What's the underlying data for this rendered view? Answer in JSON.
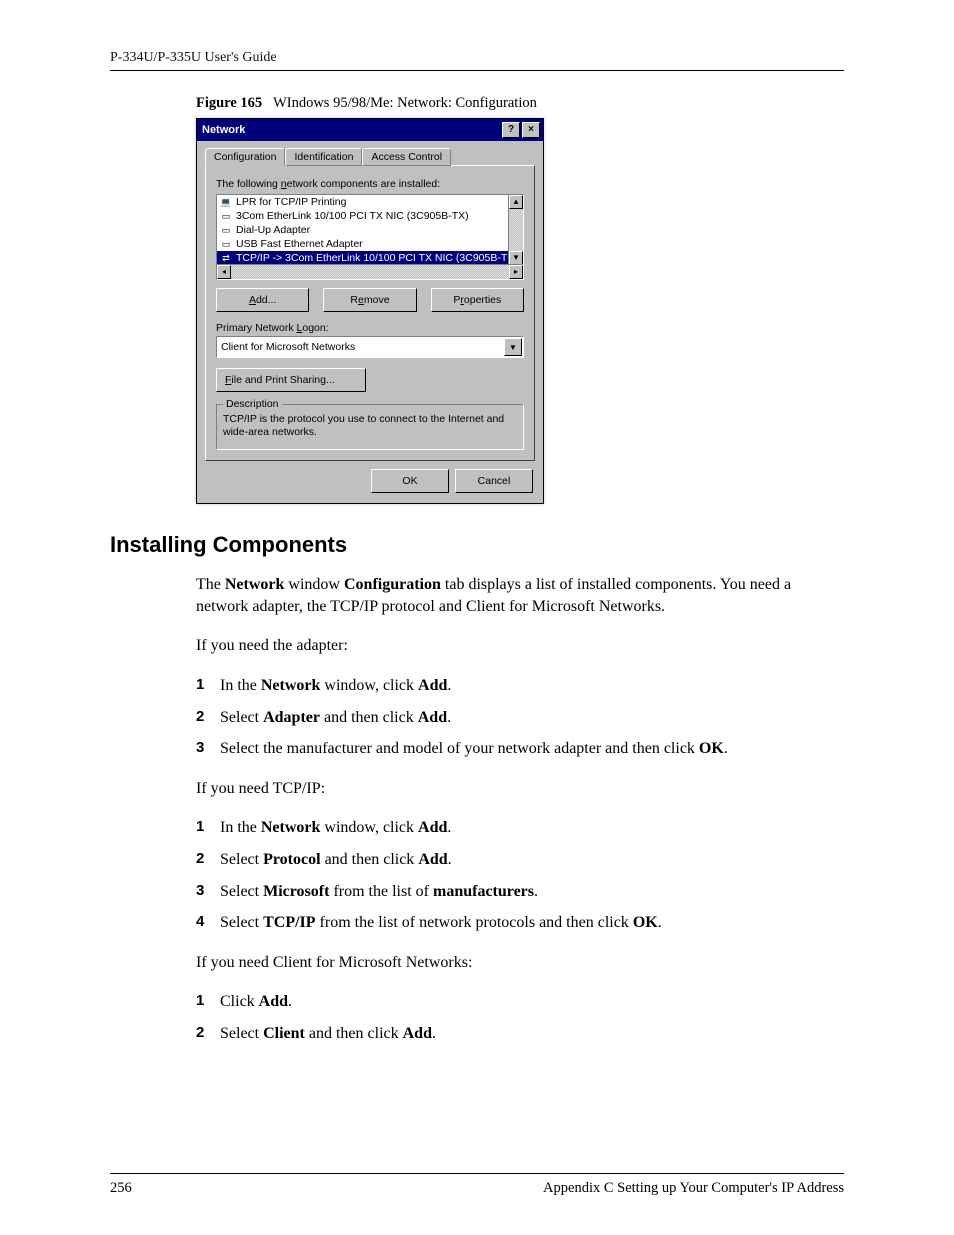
{
  "header": {
    "runningHead": "P-334U/P-335U User's Guide"
  },
  "figure": {
    "label": "Figure 165",
    "caption": "WIndows 95/98/Me: Network: Configuration"
  },
  "dialog": {
    "title": "Network",
    "tabs": [
      "Configuration",
      "Identification",
      "Access Control"
    ],
    "activeTab": 0,
    "listLabelPre": "The following ",
    "listLabelUnderline": "n",
    "listLabelPost": "etwork components are installed:",
    "listItems": [
      "LPR for TCP/IP Printing",
      "3Com EtherLink 10/100 PCI TX NIC (3C905B-TX)",
      "Dial-Up Adapter",
      "USB Fast Ethernet Adapter",
      "TCP/IP -> 3Com EtherLink 10/100 PCI TX NIC (3C905B-T"
    ],
    "selectedIndex": 4,
    "btnAdd": "Add...",
    "btnRemove": "Remove",
    "btnProperties": "Properties",
    "logonLabelPre": "Primary Network ",
    "logonLabelUnderline": "L",
    "logonLabelPost": "ogon:",
    "logonValue": "Client for Microsoft Networks",
    "btnFileShareUnderline": "F",
    "btnFileSharePost": "ile and Print Sharing...",
    "descLegend": "Description",
    "descText": "TCP/IP is the protocol you use to connect to the Internet and wide-area networks.",
    "btnOk": "OK",
    "btnCancel": "Cancel"
  },
  "section": {
    "heading": "Installing Components"
  },
  "body": {
    "intro": {
      "pre": "The ",
      "b1": "Network",
      "mid1": " window ",
      "b2": "Configuration",
      "post": " tab displays a list of installed components. You need a network adapter, the TCP/IP protocol and Client for Microsoft Networks."
    },
    "needAdapter": "If you need the adapter:",
    "adapterSteps": [
      {
        "pre": "In the ",
        "b1": "Network",
        "mid": " window, click ",
        "b2": "Add",
        "post": "."
      },
      {
        "pre": "Select ",
        "b1": "Adapter",
        "mid": " and then click ",
        "b2": "Add",
        "post": "."
      },
      {
        "pre": "Select the manufacturer and model of your network adapter and then click ",
        "b1": "OK",
        "post": "."
      }
    ],
    "needTcp": "If you need TCP/IP:",
    "tcpSteps": [
      {
        "pre": "In the ",
        "b1": "Network",
        "mid": " window, click ",
        "b2": "Add",
        "post": "."
      },
      {
        "pre": "Select ",
        "b1": "Protocol",
        "mid": " and then click ",
        "b2": "Add",
        "post": "."
      },
      {
        "pre": "Select ",
        "b1": "Microsoft",
        "mid": " from the list of ",
        "b2": "manufacturers",
        "post": "."
      },
      {
        "pre": "Select ",
        "b1": "TCP/IP",
        "mid": " from the list of network protocols and then click ",
        "b2": "OK",
        "post": "."
      }
    ],
    "needClient": "If you need Client for Microsoft Networks:",
    "clientSteps": [
      {
        "pre": "Click ",
        "b1": "Add",
        "post": "."
      },
      {
        "pre": "Select ",
        "b1": "Client",
        "mid": " and then click ",
        "b2": "Add",
        "post": "."
      }
    ]
  },
  "footer": {
    "pageNum": "256",
    "appendix": "Appendix C Setting up Your Computer's IP Address"
  }
}
